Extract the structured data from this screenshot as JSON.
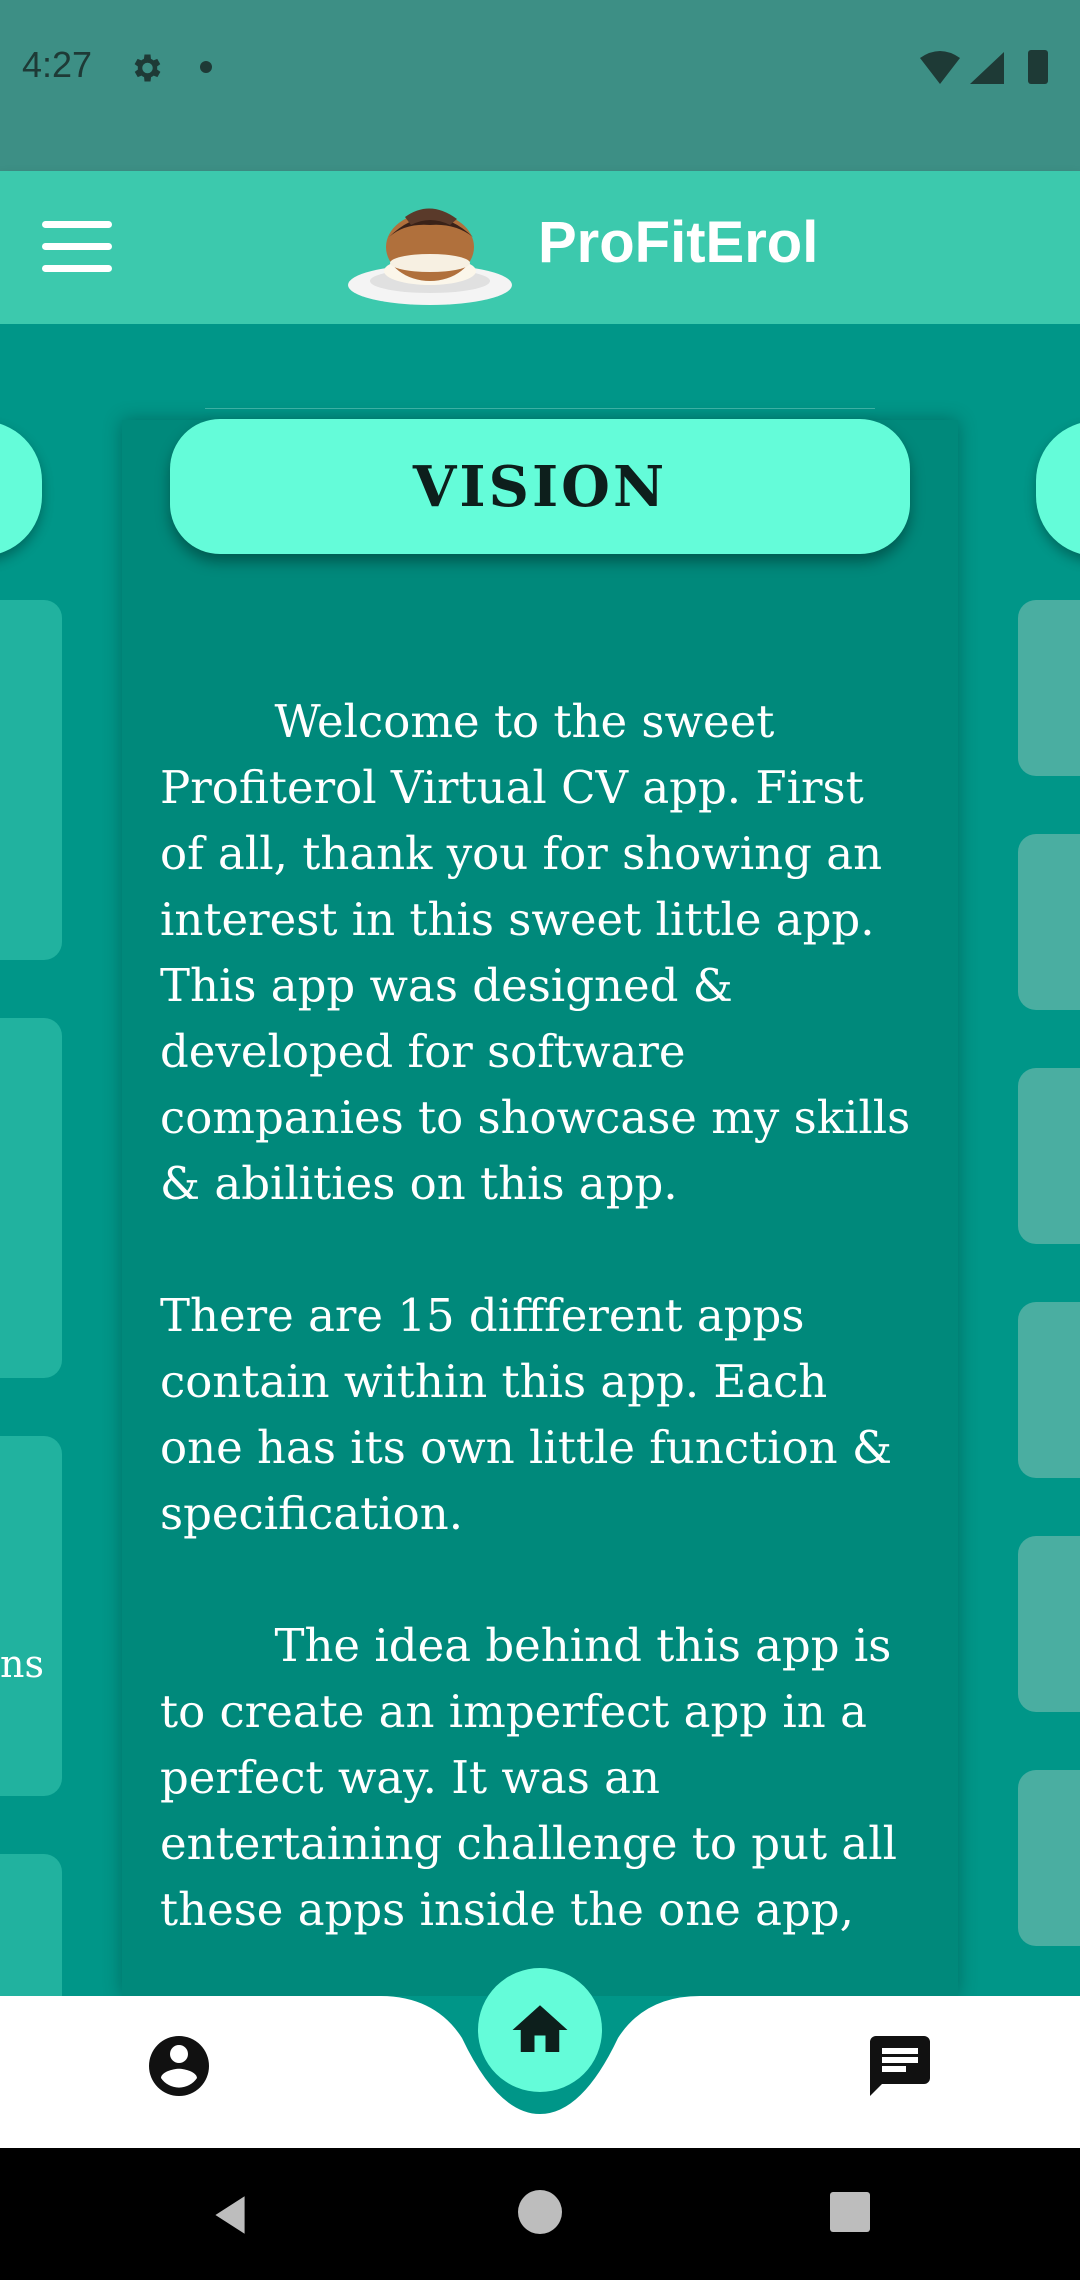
{
  "status_bar": {
    "time": "4:27",
    "icons": [
      "gear-icon",
      "notification-dot-icon",
      "wifi-icon",
      "signal-icon",
      "battery-icon"
    ]
  },
  "app_bar": {
    "title": "ProFitErol",
    "menu_icon": "hamburger-menu-icon",
    "logo": "profiterole-logo"
  },
  "card": {
    "header": "VISION",
    "paragraphs": [
      "        Welcome to the sweet Profiterol Virtual CV app. First of all, thank you for showing an interest in this sweet little app. This app was designed & developed for software companies to showcase my skills & abilities on this app.",
      "There are 15 diffferent apps contain within this app. Each one has its own little function & specification.",
      "        The idea behind this app is to create an imperfect app in a perfect way. It was an entertaining challenge to put all these apps inside the one app,"
    ]
  },
  "left_peek": {
    "text_fragment": "ns"
  },
  "bottom_nav": {
    "items": [
      "profile-icon",
      "home-icon",
      "chat-icon"
    ]
  },
  "system_nav": {
    "items": [
      "back-icon",
      "home-circle-icon",
      "recents-icon"
    ]
  },
  "colors": {
    "status_bar": "#3d8f85",
    "app_bar": "#3cc9ad",
    "background": "#009688",
    "card": "#00897b",
    "accent": "#64fcd9"
  }
}
